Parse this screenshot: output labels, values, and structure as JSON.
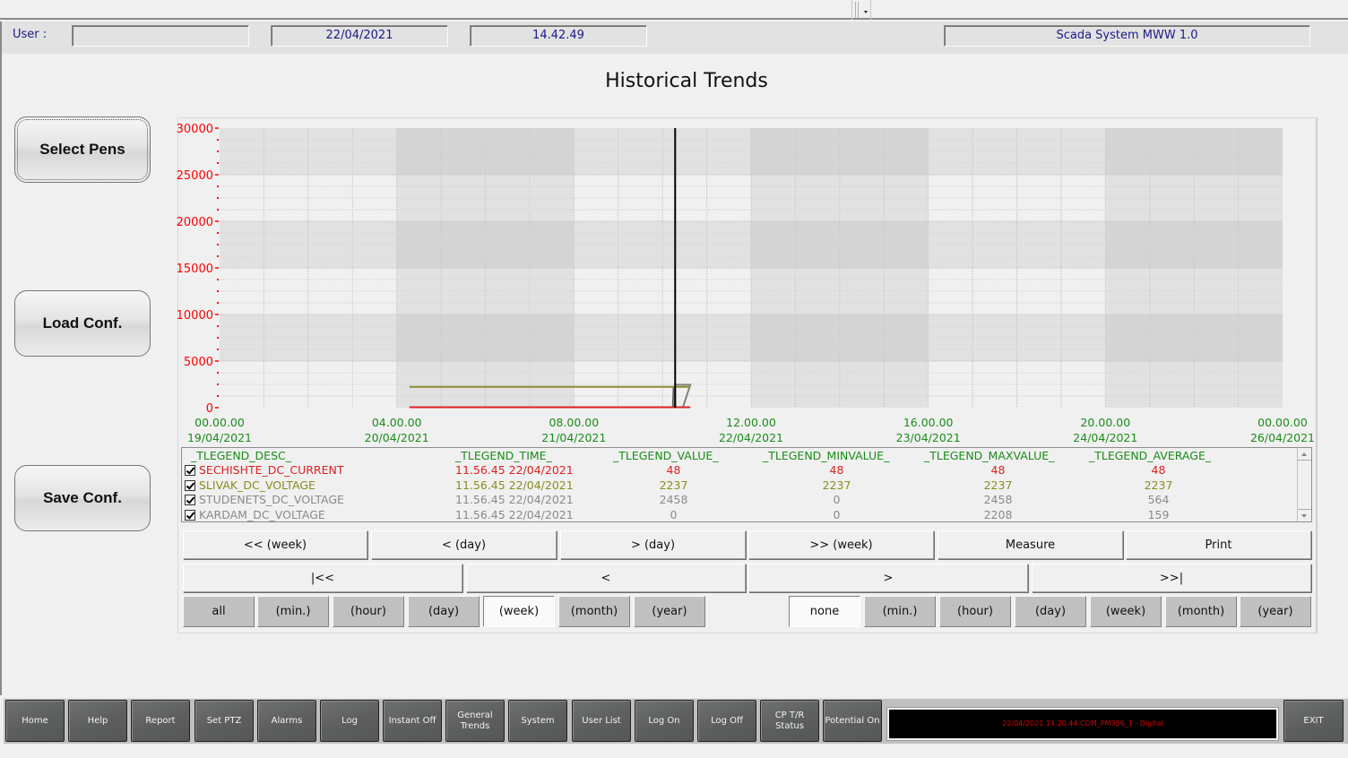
{
  "header": {
    "user_label": "User :",
    "user_value": "",
    "date": "22/04/2021",
    "time": "14.42.49",
    "system_name": "Scada System MWW 1.0"
  },
  "page": {
    "title": "Historical Trends"
  },
  "side_buttons": {
    "select_pens": "Select Pens",
    "load_conf": "Load Conf.",
    "save_conf": "Save Conf."
  },
  "chart_data": {
    "type": "line",
    "title": "",
    "xlabel": "",
    "ylabel": "",
    "ylim": [
      0,
      30000
    ],
    "y_ticks": [
      "0",
      "5000",
      "10000",
      "15000",
      "20000",
      "25000",
      "30000"
    ],
    "y_tick_color": "#ff0000",
    "x_ticks": [
      {
        "time": "00.00.00",
        "date": "19/04/2021"
      },
      {
        "time": "04.00.00",
        "date": "20/04/2021"
      },
      {
        "time": "08.00.00",
        "date": "21/04/2021"
      },
      {
        "time": "12.00.00",
        "date": "22/04/2021"
      },
      {
        "time": "16.00.00",
        "date": "23/04/2021"
      },
      {
        "time": "20.00.00",
        "date": "24/04/2021"
      },
      {
        "time": "00.00.00",
        "date": "26/04/2021"
      }
    ],
    "x_tick_color": "#1a8c1a",
    "x_range_days": [
      0,
      7
    ],
    "cursor_day": 3.0,
    "grid": true,
    "series": [
      {
        "name": "SECHISHTE_DC_CURRENT",
        "color": "#e02020",
        "points": [
          [
            1.25,
            48
          ],
          [
            3.0,
            48
          ],
          [
            3.1,
            48
          ]
        ]
      },
      {
        "name": "SLIVAK_DC_VOLTAGE",
        "color": "#8c8c30",
        "points": [
          [
            1.25,
            2237
          ],
          [
            3.0,
            2237
          ],
          [
            3.1,
            2237
          ]
        ]
      },
      {
        "name": "STUDENETS_DC_VOLTAGE",
        "color": "#808080",
        "points": [
          [
            2.99,
            0
          ],
          [
            3.0,
            2458
          ],
          [
            3.1,
            2458
          ],
          [
            3.05,
            0
          ]
        ]
      },
      {
        "name": "KARDAM_DC_VOLTAGE",
        "color": "#606060",
        "points": [
          [
            2.985,
            0
          ],
          [
            2.99,
            2208
          ],
          [
            3.0,
            2208
          ],
          [
            3.0,
            0
          ]
        ]
      }
    ]
  },
  "legend": {
    "headers": [
      "_TLEGEND_DESC_",
      "_TLEGEND_TIME_",
      "_TLEGEND_VALUE_",
      "_TLEGEND_MINVALUE_",
      "_TLEGEND_MAXVALUE_",
      "_TLEGEND_AVERAGE_"
    ],
    "header_color": "#1a8c1a",
    "rows": [
      {
        "checked": true,
        "desc": "SECHISHTE_DC_CURRENT",
        "time": "11.56.45 22/04/2021",
        "value": "48",
        "min": "48",
        "max": "48",
        "avg": "48",
        "color": "#e02020"
      },
      {
        "checked": true,
        "desc": "SLIVAK_DC_VOLTAGE",
        "time": "11.56.45 22/04/2021",
        "value": "2237",
        "min": "2237",
        "max": "2237",
        "avg": "2237",
        "color": "#8c8c20"
      },
      {
        "checked": true,
        "desc": "STUDENETS_DC_VOLTAGE",
        "time": "11.56.45 22/04/2021",
        "value": "2458",
        "min": "0",
        "max": "2458",
        "avg": "564",
        "color": "#8a8a8a"
      },
      {
        "checked": true,
        "desc": "KARDAM_DC_VOLTAGE",
        "time": "11.56.45 22/04/2021",
        "value": "0",
        "min": "0",
        "max": "2208",
        "avg": "159",
        "color": "#8a8a8a"
      }
    ]
  },
  "nav_row1": [
    "<< (week)",
    "< (day)",
    "> (day)",
    ">> (week)",
    "Measure",
    "Print"
  ],
  "nav_row2": [
    "|<<",
    "<",
    ">",
    ">>|"
  ],
  "range_left": {
    "options": [
      "all",
      "(min.)",
      "(hour)",
      "(day)",
      "(week)",
      "(month)",
      "(year)"
    ],
    "selected": "(week)"
  },
  "range_right": {
    "options": [
      "none",
      "(min.)",
      "(hour)",
      "(day)",
      "(week)",
      "(month)",
      "(year)"
    ],
    "selected": "none"
  },
  "footer": {
    "buttons": [
      "Home",
      "Help",
      "Report",
      "Set PTZ",
      "Alarms",
      "Log",
      "Instant Off",
      "General Trends",
      "System",
      "User List",
      "Log On",
      "Log Off",
      "CP T/R Status",
      "Potential On"
    ],
    "message": "22/04/2021 14.20.44 COM_PM356_1 - Digital",
    "message_color": "#e00000",
    "exit_label": "EXIT"
  }
}
